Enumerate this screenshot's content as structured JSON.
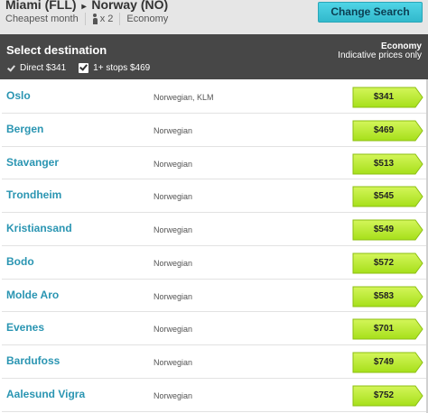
{
  "search": {
    "origin": "Miami (FLL)",
    "destination": "Norway (NO)",
    "month": "Cheapest month",
    "passengers": "x 2",
    "cabin": "Economy",
    "change_label": "Change Search"
  },
  "panel": {
    "title": "Select destination",
    "cabin_label": "Economy",
    "price_note": "Indicative prices only",
    "filters": [
      {
        "label": "Direct $341",
        "checked": true
      },
      {
        "label": "1+ stops $469",
        "checked": true
      }
    ]
  },
  "colors": {
    "accent": "#2a95b2",
    "price_green": "#b7ec2c",
    "button_cyan": "#3cc6d9",
    "header_dark": "#474747"
  },
  "destinations": [
    {
      "city": "Oslo",
      "airline": "Norwegian, KLM",
      "price": "$341"
    },
    {
      "city": "Bergen",
      "airline": "Norwegian",
      "price": "$469"
    },
    {
      "city": "Stavanger",
      "airline": "Norwegian",
      "price": "$513"
    },
    {
      "city": "Trondheim",
      "airline": "Norwegian",
      "price": "$545"
    },
    {
      "city": "Kristiansand",
      "airline": "Norwegian",
      "price": "$549"
    },
    {
      "city": "Bodo",
      "airline": "Norwegian",
      "price": "$572"
    },
    {
      "city": "Molde Aro",
      "airline": "Norwegian",
      "price": "$583"
    },
    {
      "city": "Evenes",
      "airline": "Norwegian",
      "price": "$701"
    },
    {
      "city": "Bardufoss",
      "airline": "Norwegian",
      "price": "$749"
    },
    {
      "city": "Aalesund Vigra",
      "airline": "Norwegian",
      "price": "$752"
    }
  ]
}
